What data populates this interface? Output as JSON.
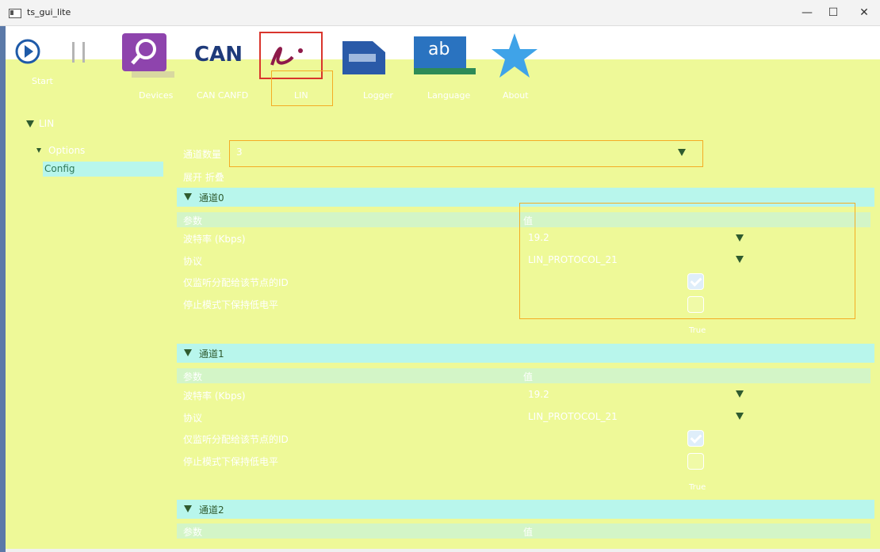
{
  "window": {
    "title": "ts_gui_lite",
    "minimize": "—",
    "maximize": "☐",
    "close": "✕"
  },
  "toolbar": {
    "start_label": "Start",
    "devices_label": "Devices",
    "can_text": "CAN",
    "can_label": "CAN CANFD",
    "lin_label": "LIN",
    "logger_label": "Logger",
    "language_text": "ab",
    "language_label": "Language",
    "about_label": "About"
  },
  "tree": {
    "root": "LIN",
    "options": "Options",
    "config": "Config"
  },
  "main": {
    "channel_count_label": "通道数量",
    "channel_count_value": "3",
    "expand_collapse": "展开 折叠",
    "channels": [
      {
        "title": "通道0",
        "col_param": "参数",
        "col_value": "值",
        "baud_label": "波特率 (Kbps)",
        "baud_value": "19.2",
        "protocol_label": "协议",
        "protocol_value": "LIN_PROTOCOL_21",
        "monitor_label": "仅监听分配给该节点的ID",
        "keep_label": "停止模式下保持低电平",
        "state": "True"
      },
      {
        "title": "通道1",
        "col_param": "参数",
        "col_value": "值",
        "baud_label": "波特率 (Kbps)",
        "baud_value": "19.2",
        "protocol_label": "协议",
        "protocol_value": "LIN_PROTOCOL_21",
        "monitor_label": "仅监听分配给该节点的ID",
        "keep_label": "停止模式下保持低电平",
        "state": "True"
      },
      {
        "title": "通道2",
        "col_param": "参数",
        "col_value": "值"
      }
    ]
  },
  "colors": {
    "background": "#eef998",
    "header": "#b8f6ec",
    "highlight": "#f4ac24",
    "selection": "#d9352c"
  }
}
